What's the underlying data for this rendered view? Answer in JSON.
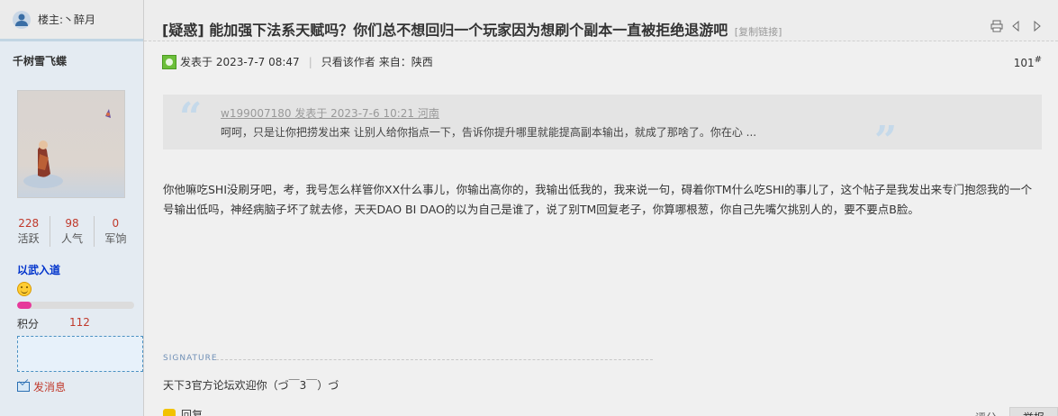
{
  "left": {
    "floor_label": "楼主:丶醉月",
    "author_name": "千树雪飞蝶",
    "stats": [
      {
        "value": "228",
        "label": "活跃"
      },
      {
        "value": "98",
        "label": "人气"
      },
      {
        "value": "0",
        "label": "军饷"
      }
    ],
    "group_name": "以武入道",
    "progress_fraction": 0.12,
    "points_label": "积分",
    "points_value": "112",
    "send_message": "发消息"
  },
  "header": {
    "title": "[疑惑] 能加强下法系天赋吗？你们总不想回归一个玩家因为想刷个副本一直被拒绝退游吧",
    "copy_link": "[复制链接]"
  },
  "meta": {
    "posted": "发表于 2023-7-7 08:47",
    "only_author": "只看该作者",
    "location": "来自：陕西",
    "floor_number": "101",
    "floor_suffix": "#"
  },
  "quote": {
    "open_mark": "“",
    "close_mark": "”",
    "header": "w199007180 发表于 2023-7-6 10:21 河南",
    "body": "呵呵，只是让你把捞发出来 让别人给你指点一下，告诉你提升哪里就能提高副本输出，就成了那啥了。你在心 ..."
  },
  "content": {
    "text": "你他嘛吃SHI没刷牙吧，考，我号怎么样管你XX什么事儿，你输出高你的，我输出低我的，我来说一句，碍着你TM什么吃SHI的事儿了，这个帖子是我发出来专门抱怨我的一个号输出低吗，神经病脑子坏了就去修，天天DAO BI DAO的以为自己是谁了，说了别TM回复老子，你算哪根葱，你自己先嘴欠挑别人的，要不要点B脸。"
  },
  "signature": {
    "label": "SIGNATURE",
    "text": "天下3官方论坛欢迎你（づ￣3￣）づ"
  },
  "bottom": {
    "left_text": "回复",
    "rate": "评分",
    "report": "举报"
  }
}
